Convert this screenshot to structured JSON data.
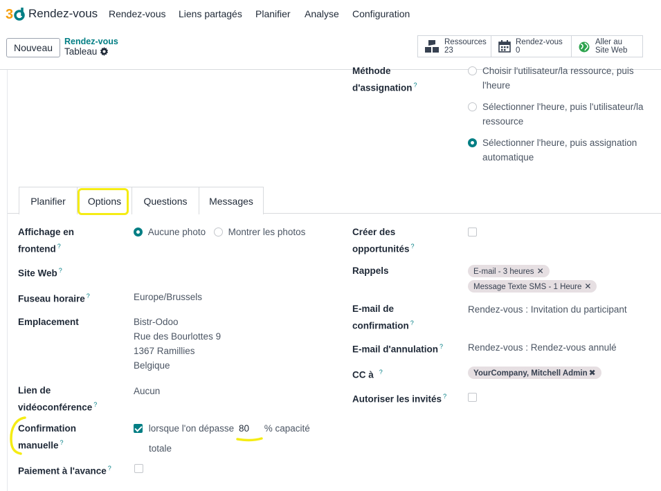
{
  "navbar": {
    "app_name": "Rendez-vous",
    "menu": [
      "Rendez-vous",
      "Liens partagés",
      "Planifier",
      "Analyse",
      "Configuration"
    ]
  },
  "control_panel": {
    "new_button": "Nouveau",
    "breadcrumb_parent": "Rendez-vous",
    "breadcrumb_current": "Tableau",
    "smart_buttons": [
      {
        "label": "Ressources",
        "value": "23",
        "icon": "resources-icon"
      },
      {
        "label": "Rendez-vous",
        "value": "0",
        "icon": "calendar-icon"
      },
      {
        "label_line1": "Aller au",
        "label_line2": "Site Web",
        "icon": "globe-icon"
      }
    ]
  },
  "assignment": {
    "label_line1": "Méthode",
    "label_line2": "d'assignation",
    "options": [
      {
        "line1": "Choisir l'utilisateur/la ressource, puis",
        "line2": "l'heure",
        "selected": false
      },
      {
        "line1": "Sélectionner l'heure, puis l'utilisateur/la",
        "line2": "ressource",
        "selected": false
      },
      {
        "line1": "Sélectionner l'heure, puis assignation",
        "line2": "automatique",
        "selected": true
      }
    ]
  },
  "tabs": [
    "Planifier",
    "Options",
    "Questions",
    "Messages"
  ],
  "active_tab": "Options",
  "options": {
    "frontend_label_1": "Affichage en",
    "frontend_label_2": "frontend",
    "frontend_opt_1": "Aucune photo",
    "frontend_opt_2": "Montrer les photos",
    "website_label": "Site Web",
    "timezone_label": "Fuseau horaire",
    "timezone_value": "Europe/Brussels",
    "location_label": "Emplacement",
    "location_lines": [
      "Bistr-Odoo",
      "Rue des Bourlottes 9",
      "1367 Ramillies",
      "Belgique"
    ],
    "video_label_1": "Lien de",
    "video_label_2": "vidéoconférence",
    "video_value": "Aucun",
    "manual_label_1": "Confirmation",
    "manual_label_2": "manuelle",
    "manual_text_before": "lorsque l'on dépasse",
    "manual_value": "80",
    "manual_text_after": "% capacité",
    "manual_text_after_2": "totale",
    "prepay_label": "Paiement à l'avance",
    "opportunities_label_1": "Créer des",
    "opportunities_label_2": "opportunités",
    "reminders_label": "Rappels",
    "reminder_tags": [
      "E-mail - 3 heures",
      "Message Texte SMS - 1 Heure"
    ],
    "confirm_mail_label_1": "E-mail de",
    "confirm_mail_label_2": "confirmation",
    "confirm_mail_value": "Rendez-vous : Invitation du participant",
    "cancel_mail_label": "E-mail d'annulation",
    "cancel_mail_value": "Rendez-vous : Rendez-vous annulé",
    "cc_label": "CC à",
    "cc_tag": "YourCompany, Mitchell Admin",
    "guests_label": "Autoriser les invités"
  },
  "colors": {
    "brand": "#017e84",
    "tag_bg": "#e6dfe2",
    "highlight": "#f5ec14"
  },
  "help_marker": "?"
}
